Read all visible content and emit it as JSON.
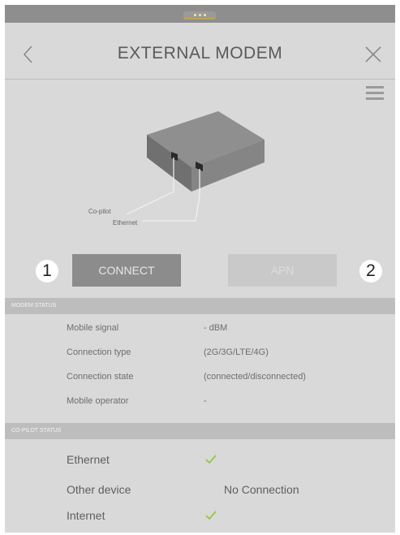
{
  "header": {
    "title": "EXTERNAL MODEM"
  },
  "diagram": {
    "label_copilot": "Co-pilot",
    "label_ethernet": "Ethernet"
  },
  "steps": {
    "step1": "1",
    "step2": "2"
  },
  "buttons": {
    "connect_label": "CONNECT",
    "apn_label": "APN"
  },
  "modem_status": {
    "section_title": "MODEM STATUS",
    "rows": [
      {
        "label": "Mobile signal",
        "value": "- dBM"
      },
      {
        "label": "Connection type",
        "value": "(2G/3G/LTE/4G)"
      },
      {
        "label": "Connection state",
        "value": "(connected/disconnected)"
      },
      {
        "label": "Mobile operator",
        "value": "-"
      }
    ]
  },
  "copilot_status": {
    "section_title": "CO-PILOT STATUS",
    "rows": [
      {
        "label": "Ethernet",
        "value": "",
        "status_icon": "check-icon"
      },
      {
        "label": "Other device",
        "value": "No Connection"
      },
      {
        "label": "Internet",
        "value": "",
        "status_icon": "check-icon"
      }
    ]
  },
  "colors": {
    "check": "#9ac43c",
    "accent_handle": "#c9a43a"
  }
}
